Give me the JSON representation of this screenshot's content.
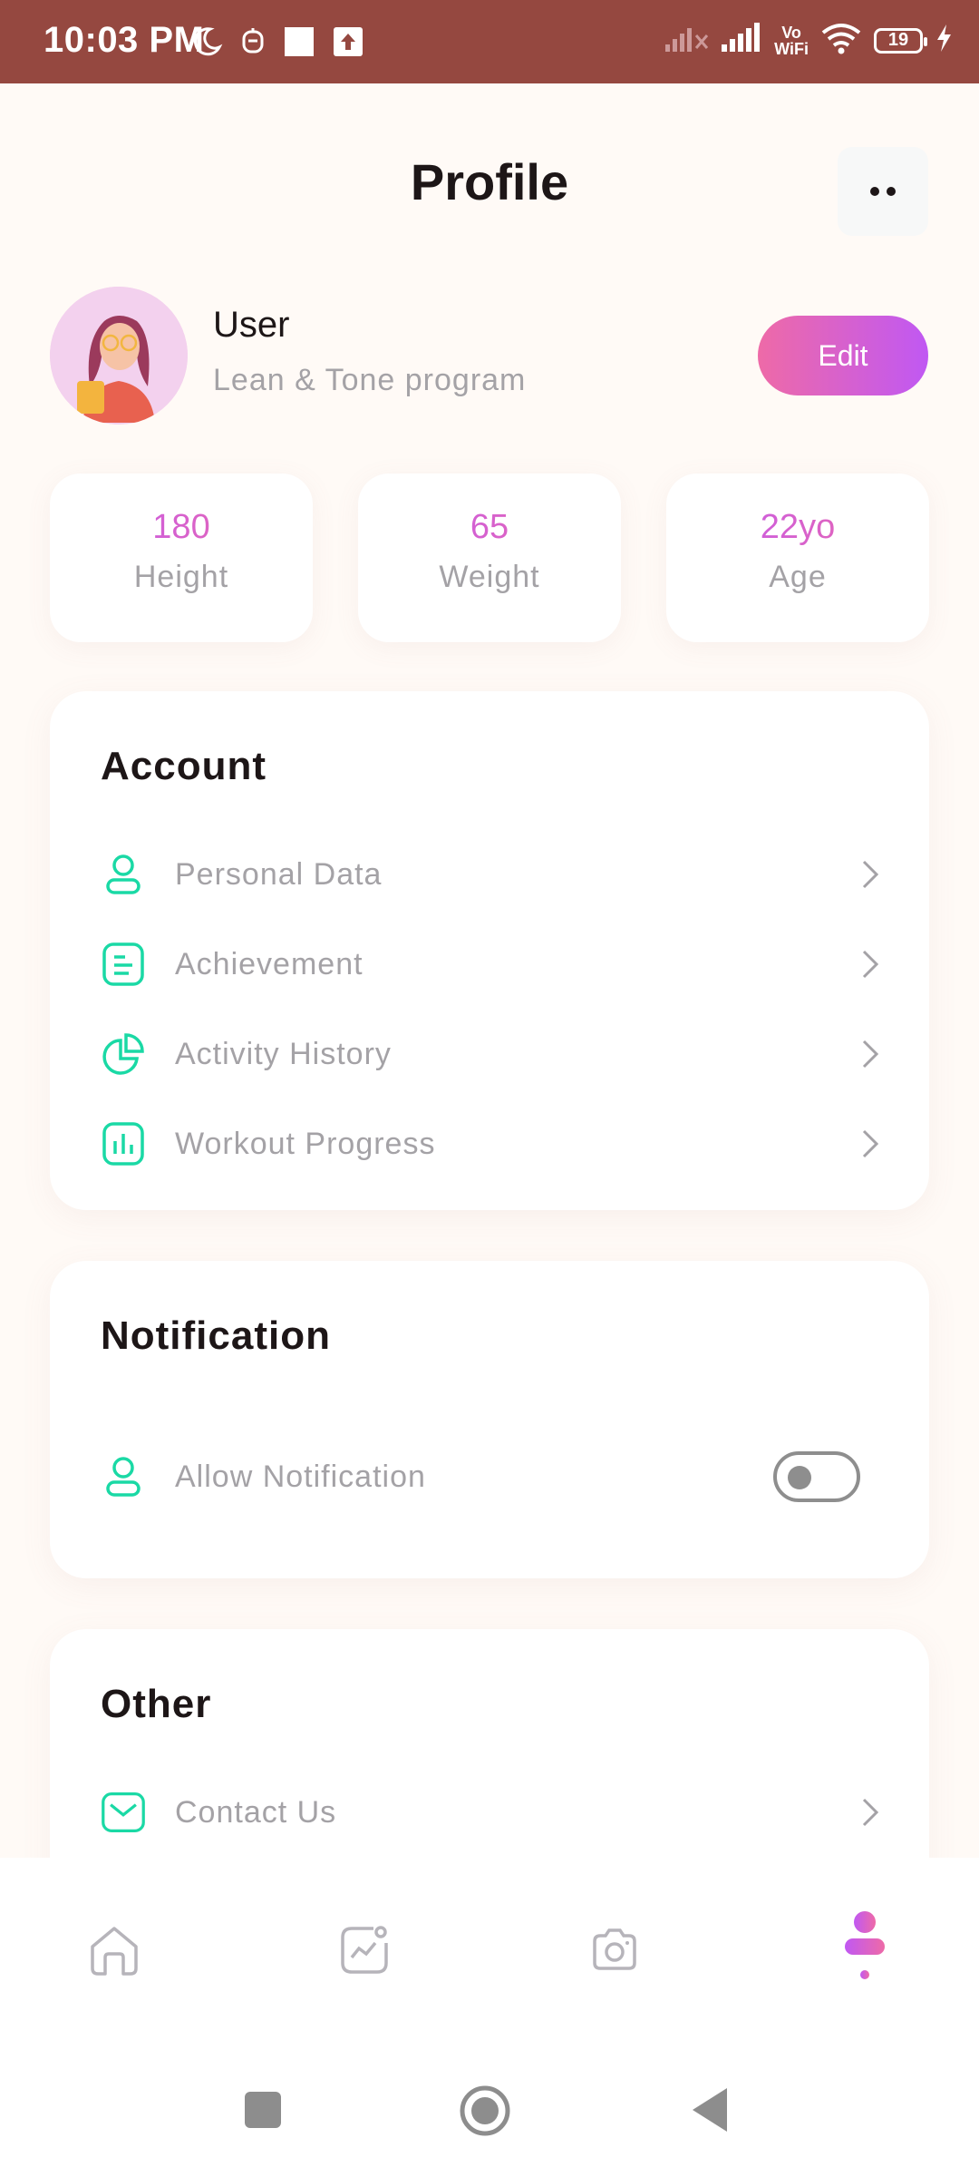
{
  "status_bar": {
    "time": "10:03 PM",
    "vo": "Vo",
    "wifi_label": "WiFi",
    "battery": "19",
    "icons": [
      "moon-icon",
      "notification-icon",
      "square-icon",
      "upload-icon",
      "signal-off-icon",
      "signal-icon",
      "wifi-icon",
      "battery-icon",
      "charging-icon"
    ]
  },
  "header": {
    "title": "Profile",
    "more_icon": "more-dots-icon"
  },
  "profile": {
    "name": "User",
    "program": "Lean & Tone program",
    "edit_label": "Edit"
  },
  "stats": [
    {
      "value": "180",
      "label": "Height"
    },
    {
      "value": "65",
      "label": "Weight"
    },
    {
      "value": "22yo",
      "label": "Age"
    }
  ],
  "account": {
    "title": "Account",
    "items": [
      {
        "label": "Personal Data",
        "icon": "person-icon"
      },
      {
        "label": "Achievement",
        "icon": "document-icon"
      },
      {
        "label": "Activity History",
        "icon": "pie-chart-icon"
      },
      {
        "label": "Workout Progress",
        "icon": "bar-chart-icon"
      }
    ]
  },
  "notification": {
    "title": "Notification",
    "item": {
      "label": "Allow Notification",
      "icon": "person-icon",
      "enabled": false
    }
  },
  "other": {
    "title": "Other",
    "items": [
      {
        "label": "Contact Us",
        "icon": "mail-icon"
      }
    ]
  },
  "bottom_nav": [
    {
      "icon": "home-icon",
      "active": false
    },
    {
      "icon": "activity-chart-icon",
      "active": false
    },
    {
      "icon": "camera-icon",
      "active": false
    },
    {
      "icon": "profile-icon",
      "active": true
    }
  ],
  "colors": {
    "status_bar": "#954840",
    "accent_teal": "#1ad9a5",
    "accent_pink": "#ee6aa7",
    "accent_purple": "#c058f3"
  }
}
